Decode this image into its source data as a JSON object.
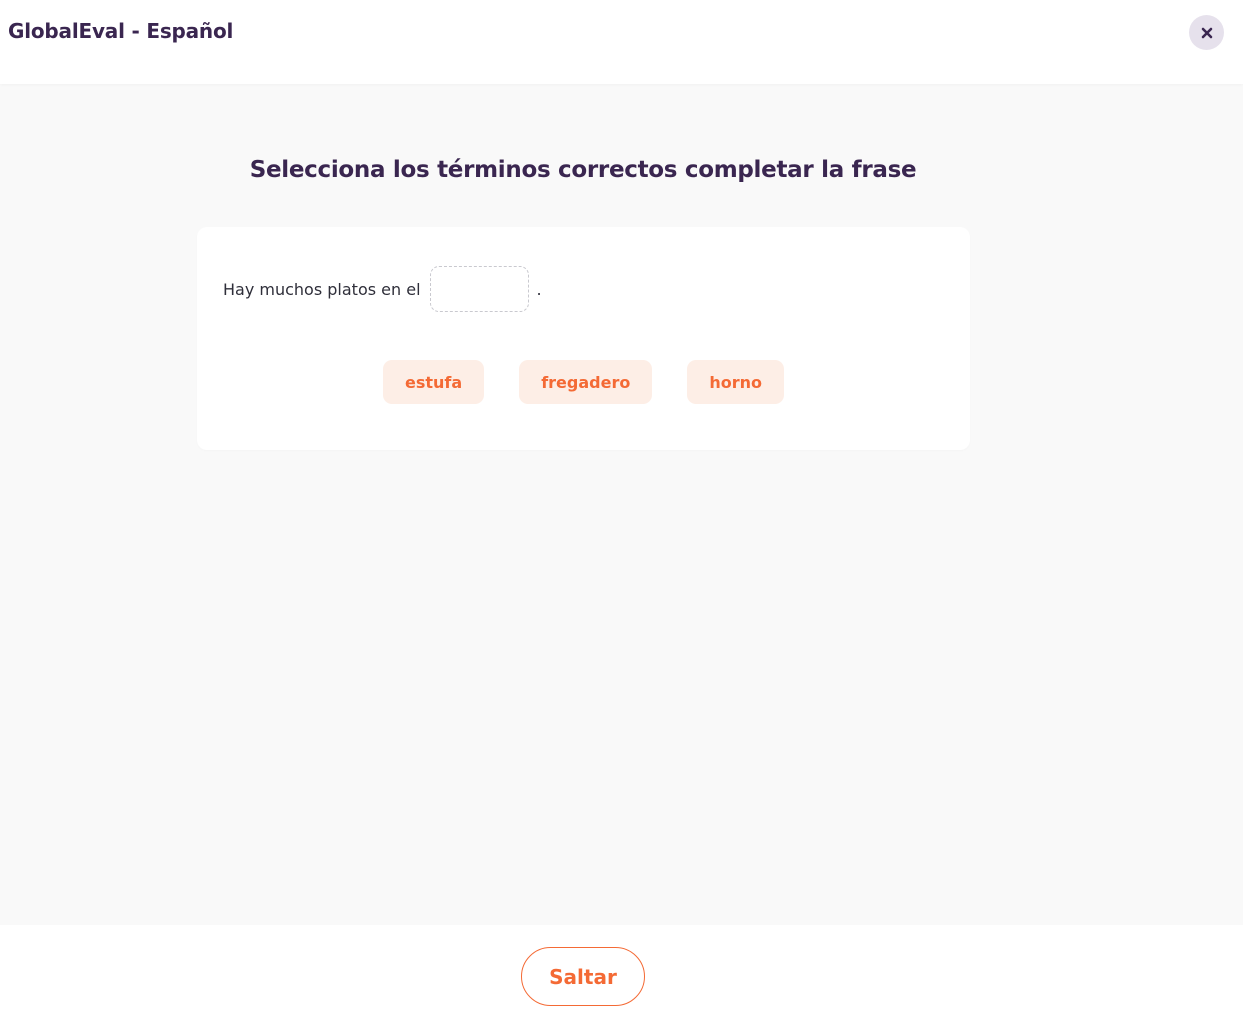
{
  "header": {
    "title": "GlobalEval - Español",
    "close_icon": "close-icon"
  },
  "question": {
    "title": "Selecciona los términos correctos completar la frase",
    "sentence_before": "Hay muchos platos en el",
    "sentence_after": ".",
    "options": [
      {
        "label": "estufa"
      },
      {
        "label": "fregadero"
      },
      {
        "label": "horno"
      }
    ]
  },
  "footer": {
    "skip_label": "Saltar"
  },
  "colors": {
    "accent": "#f46a35",
    "accent_bg": "#fdeee6",
    "title": "#3a2650",
    "close_bg": "#e6e1ec"
  }
}
